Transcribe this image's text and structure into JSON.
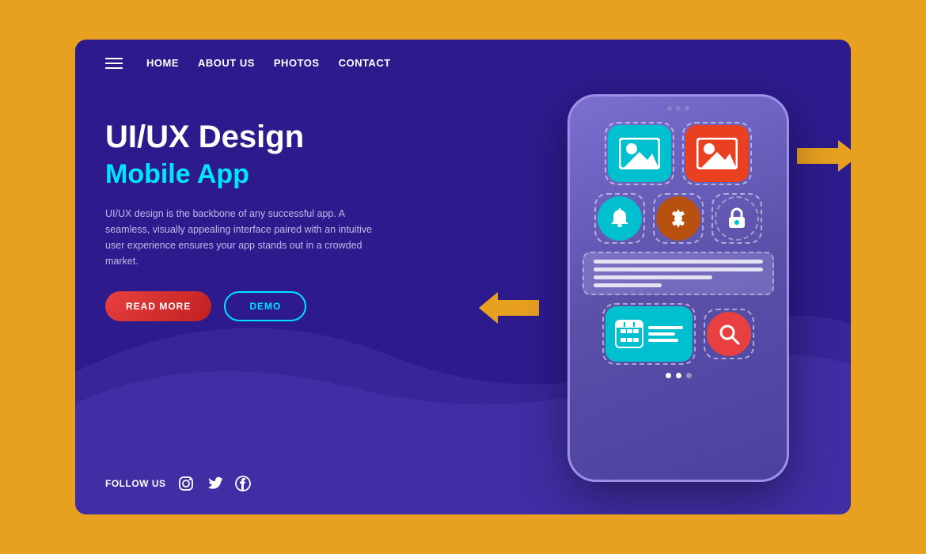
{
  "card": {
    "background_color": "#2D1B8E"
  },
  "navbar": {
    "hamburger_label": "menu",
    "links": [
      {
        "label": "HOME",
        "id": "nav-home"
      },
      {
        "label": "ABOUT US",
        "id": "nav-about"
      },
      {
        "label": "PHOTOS",
        "id": "nav-photos"
      },
      {
        "label": "CONTACT",
        "id": "nav-contact"
      }
    ]
  },
  "hero": {
    "heading_main": "UI/UX Design",
    "heading_sub": "Mobile App",
    "description": "UI/UX design is the backbone of any successful app. A seamless, visually appealing interface paired with an intuitive user experience ensures your app stands out in a crowded market.",
    "btn_read_more": "READ MORE",
    "btn_demo": "DEMO"
  },
  "follow": {
    "label": "FOLLOW US"
  },
  "phone": {
    "dots_top": [
      "dot",
      "dot",
      "dot"
    ],
    "pagination_dots": [
      {
        "active": true
      },
      {
        "active": true
      },
      {
        "active": false
      }
    ]
  },
  "colors": {
    "accent_teal": "#00BFCF",
    "accent_red": "#E84020",
    "nav_text": "#FFFFFF",
    "heading_sub": "#00E5FF",
    "background": "#2D1B8E",
    "outer": "#E8A020"
  }
}
